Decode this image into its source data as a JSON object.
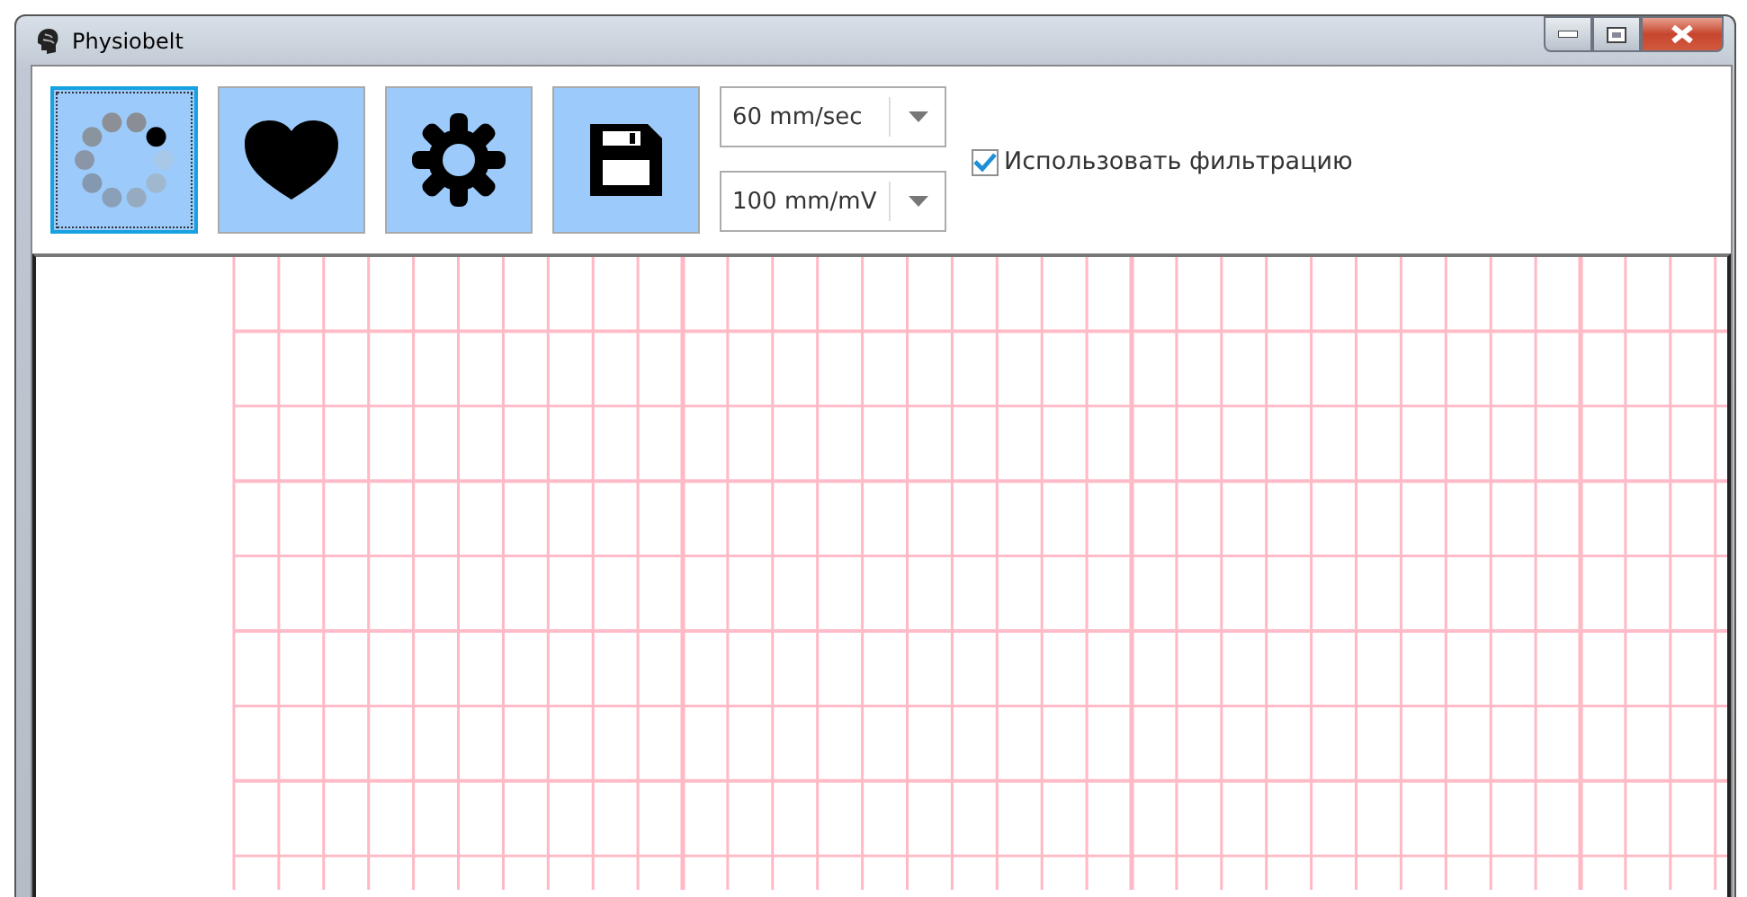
{
  "window": {
    "title": "Physiobelt"
  },
  "toolbar": {
    "buttons": [
      {
        "kind": "spinner",
        "focused": true
      },
      {
        "kind": "heart",
        "focused": false
      },
      {
        "kind": "gear",
        "focused": false
      },
      {
        "kind": "save",
        "focused": false
      }
    ]
  },
  "speed_dropdown": {
    "value": "60 mm/sec"
  },
  "gain_dropdown": {
    "value": "100 mm/mV"
  },
  "filter_checkbox": {
    "label": "Использовать фильтрацию",
    "checked": true
  }
}
